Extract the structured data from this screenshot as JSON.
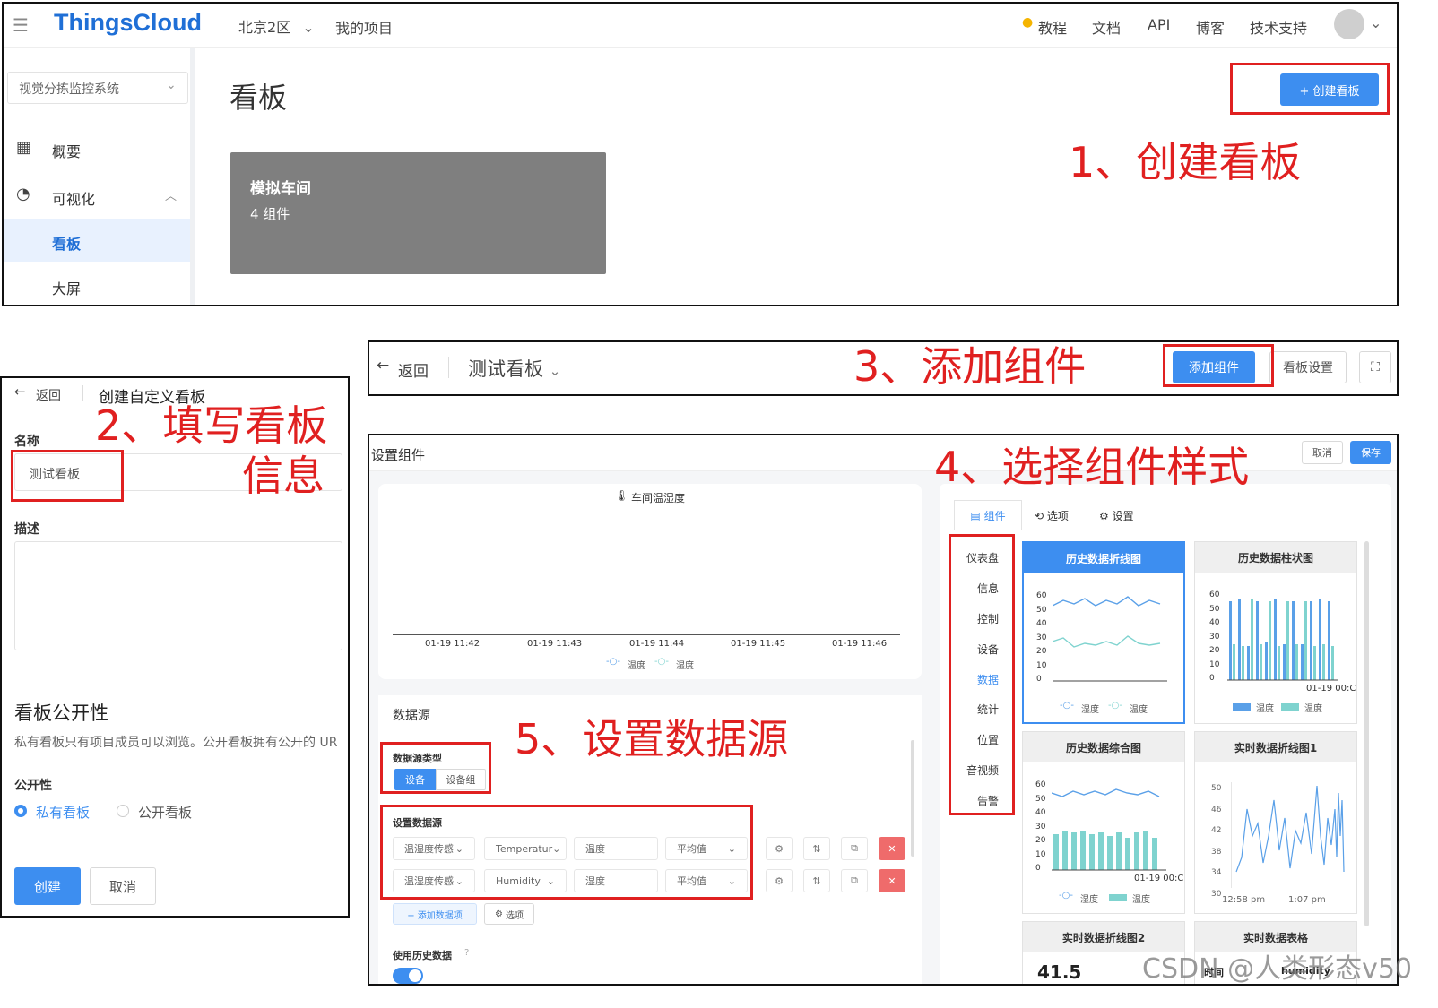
{
  "panel1": {
    "brand": "ThingsCloud",
    "region": "北京2区",
    "my_projects": "我的项目",
    "nav": [
      "教程",
      "文档",
      "API",
      "博客",
      "技术支持"
    ],
    "project_select": "视觉分拣监控系统",
    "sidebar": {
      "overview": "概要",
      "visual": "可视化",
      "board": "看板",
      "bigscreen": "大屏"
    },
    "page_title": "看板",
    "create_button": "+ 创建看板",
    "card": {
      "title": "模拟车间",
      "subtitle": "4 组件"
    }
  },
  "panel2": {
    "back": "返回",
    "title": "创建自定义看板",
    "name_label": "名称",
    "name_value": "测试看板",
    "desc_label": "描述",
    "public_heading": "看板公开性",
    "public_desc": "私有看板只有项目成员可以浏览。公开看板拥有公开的 UR",
    "visibility_label": "公开性",
    "radio_private": "私有看板",
    "radio_public": "公开看板",
    "create": "创建",
    "cancel": "取消"
  },
  "panel3": {
    "back": "返回",
    "board_name": "测试看板",
    "add_widget": "添加组件",
    "board_settings": "看板设置"
  },
  "panel4": {
    "header": "设置组件",
    "cancel": "取消",
    "save": "保存",
    "preview_title": "车间温湿度",
    "preview_ticks": [
      "01-19 11:42",
      "01-19 11:43",
      "01-19 11:44",
      "01-19 11:45",
      "01-19 11:46"
    ],
    "preview_legend": [
      "温度",
      "湿度"
    ],
    "datasource_heading": "数据源",
    "ds_type_label": "数据源类型",
    "ds_type_options": [
      "设备",
      "设备组"
    ],
    "set_ds_label": "设置数据源",
    "rows": [
      {
        "device": "温湿度传感",
        "attr": "Temperatur",
        "name": "温度",
        "agg": "平均值"
      },
      {
        "device": "温湿度传感",
        "attr": "Humidity",
        "name": "湿度",
        "agg": "平均值"
      }
    ],
    "add_item": "+ 添加数据项",
    "options": "选项",
    "use_history": "使用历史数据",
    "tabs": [
      "组件",
      "选项",
      "设置"
    ],
    "categories": [
      "仪表盘",
      "信息",
      "控制",
      "设备",
      "数据",
      "统计",
      "位置",
      "音视频",
      "告警"
    ],
    "thumbs": {
      "t1": "历史数据折线图",
      "t2": "历史数据柱状图",
      "t3": "历史数据综合图",
      "t4": "实时数据折线图1",
      "t5": "实时数据折线图2",
      "t6": "实时数据表格"
    },
    "axis_60": [
      "60",
      "50",
      "40",
      "30",
      "20",
      "10",
      "0"
    ],
    "axis_50": [
      "50",
      "46",
      "42",
      "38",
      "34",
      "30"
    ],
    "t1_legend": [
      "湿度",
      "温度"
    ],
    "t2_legend": [
      "湿度",
      "温度"
    ],
    "t3_legend": [
      "湿度",
      "温度"
    ],
    "t2_xlabel": "01-19 00:C",
    "t3_xlabel": "01-19 00:C",
    "t4_xlabels": [
      "12:58 pm",
      "1:07 pm"
    ],
    "t5_value": "41.5",
    "t6_cols": [
      "时间",
      "humidity"
    ]
  },
  "annotations": {
    "a1": "1、创建看板",
    "a2a": "2、填写看板",
    "a2b": "信息",
    "a3": "3、添加组件",
    "a4": "4、选择组件样式",
    "a5": "5、设置数据源"
  },
  "watermark": "CSDN @人类形态v50",
  "colors": {
    "primary": "#3d8ef0",
    "annotation": "#e02020",
    "brand": "#1f6fd6",
    "danger": "#ef6b6b",
    "teal": "#7fd3cf"
  }
}
